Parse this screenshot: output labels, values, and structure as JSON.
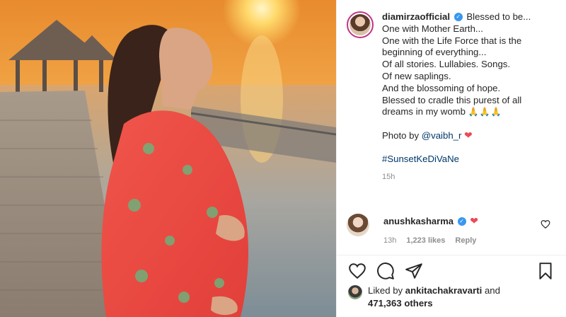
{
  "post": {
    "username": "diamirzaofficial",
    "caption_lines": [
      "Blessed to be...",
      "One with Mother Earth...",
      "One with the Life Force that is the",
      "beginning of everything...",
      "Of all stories. Lullabies. Songs.",
      "Of new saplings.",
      "And the blossoming of hope.",
      "Blessed to cradle this purest of all",
      "dreams in my womb"
    ],
    "pray_emojis": "🙏🙏🙏",
    "photo_by_label": "Photo by",
    "photo_by_handle": "@vaibh_r",
    "heart_emoji": "❤",
    "hashtag": "#SunsetKeDiVaNe",
    "time": "15h"
  },
  "comment": {
    "username": "anushkasharma",
    "heart_emoji": "❤",
    "time": "13h",
    "likes": "1,223 likes",
    "reply_label": "Reply"
  },
  "likes_summary": {
    "liked_by_label": "Liked by",
    "liked_by_user": "ankitachakravarti",
    "and_label": "and",
    "others_count": "471,363 others"
  },
  "icons": {
    "like": "heart-outline-icon",
    "comment": "comment-bubble-icon",
    "share": "paper-plane-icon",
    "save": "bookmark-icon",
    "verified": "verified-badge-icon"
  },
  "colors": {
    "verified": "#3897f0",
    "link": "#00376b",
    "heart": "#ed4956",
    "muted": "#8e8e8e",
    "avatar_ring": "#c13584"
  }
}
